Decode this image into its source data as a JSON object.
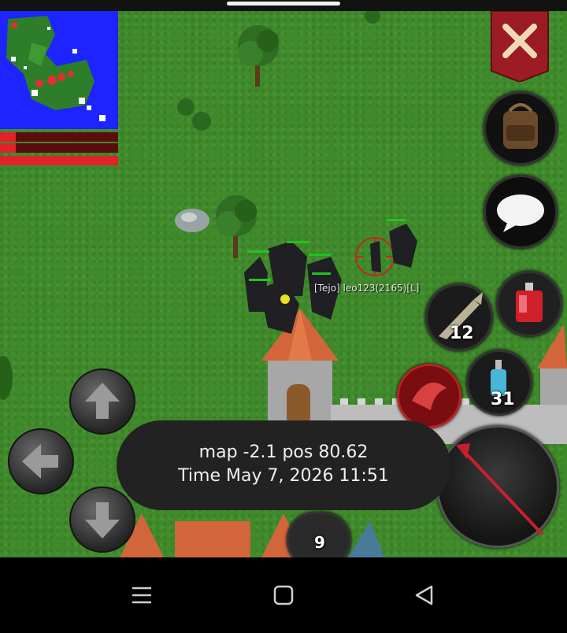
{
  "player": {
    "label": "[Tejo] leo123(2165)[L]"
  },
  "hotbar": {
    "fish_count": "12",
    "potion_count": "31",
    "slot_bottom_count": "9"
  },
  "toast": {
    "line1": "map -2.1 pos 80.62",
    "line2": "Time May 7, 2026 11:51"
  },
  "colors": {
    "grass": "#3f8a2a",
    "minimap_water": "#1d24ff",
    "health_red": "#e0222a",
    "guild_banner": "#9b1c24",
    "toast_bg": "#222222"
  },
  "status_bars": {
    "bar1_fill": 0.13,
    "bar2_fill": 0.13,
    "bar3_fill": 1.0
  },
  "icons": [
    "backpack-icon",
    "chat-bubble-icon",
    "fish-icon",
    "health-potion-icon",
    "mana-potion-icon",
    "weapon-staff-icon",
    "skill-icon",
    "arrow-up-icon",
    "arrow-left-icon",
    "arrow-down-icon",
    "menu-icon",
    "home-icon",
    "back-icon",
    "guild-banner-icon"
  ]
}
